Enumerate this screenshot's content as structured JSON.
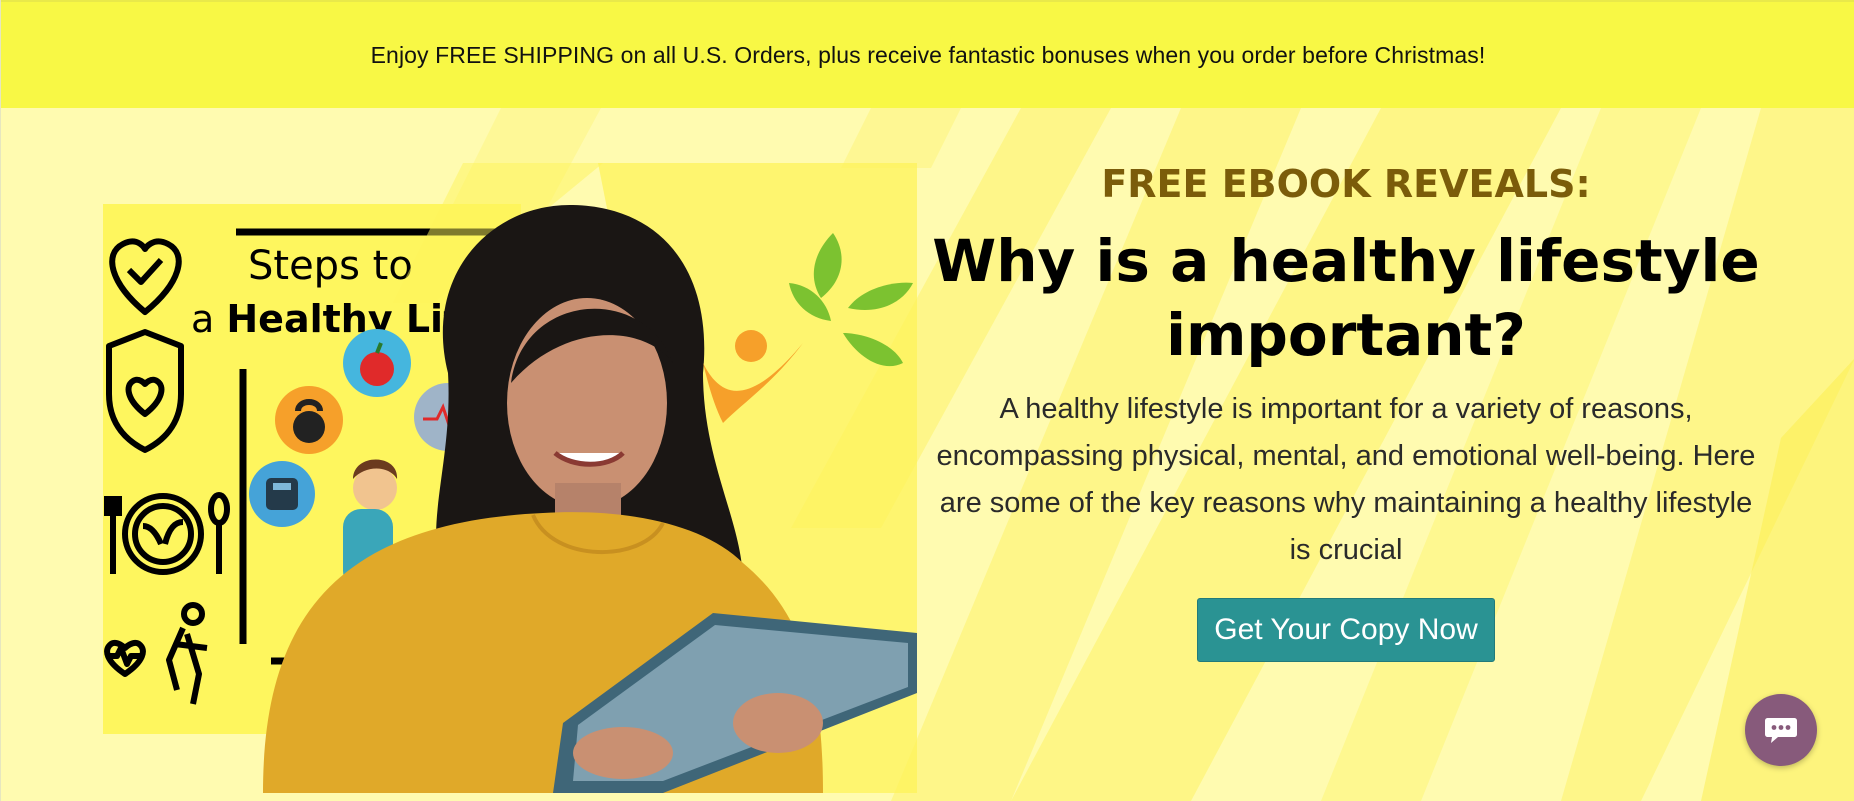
{
  "announcement": {
    "text": "Enjoy FREE SHIPPING on all U.S. Orders, plus receive fantastic bonuses when you order before Christmas!"
  },
  "hero": {
    "ebook_cover": {
      "title_line1": "Steps to",
      "title_line2_prefix": "a ",
      "title_line2_bold": "Healthy Life",
      "icons": [
        "heart-check-icon",
        "shield-heart-icon",
        "plate-utensils-icon",
        "heartbeat-figure-icon",
        "kettlebell-icon",
        "apple-icon",
        "heart-rate-icon",
        "scale-icon",
        "meditating-person-icon"
      ]
    },
    "photo_alt": "woman-with-tablet",
    "logo_icon": "leaf-figure-logo-icon",
    "eyebrow": "FREE EBOOK REVEALS:",
    "headline": "Why is a healthy lifestyle important?",
    "body": "A healthy lifestyle is important for a variety of reasons, encompassing physical, mental, and emotional well-being. Here are some of the key reasons why maintaining a healthy lifestyle is crucial",
    "cta_label": "Get Your Copy Now"
  },
  "chat": {
    "icon": "chat-bubble-icon"
  },
  "colors": {
    "announcement_bg": "#f8f845",
    "hero_bg": "#fffbb0",
    "eyebrow": "#7b5c0a",
    "cta_bg": "#2a9393",
    "chat_bg": "#875a7b"
  }
}
